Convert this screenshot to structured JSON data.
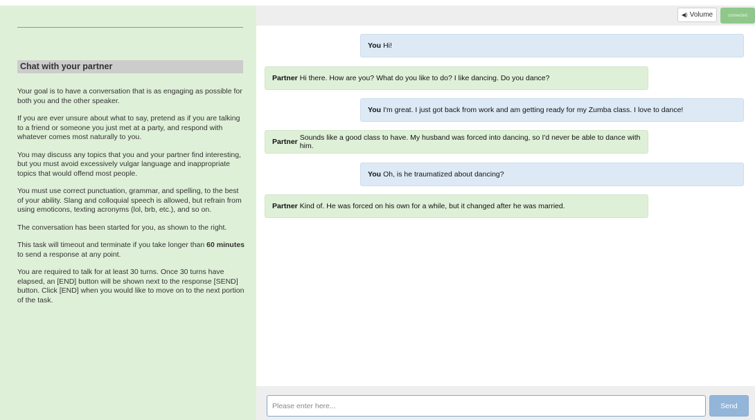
{
  "sidebar": {
    "heading": "Chat with your partner",
    "paragraphs": [
      "Your goal is to have a conversation that is as engaging as possible for both you and the other speaker.",
      "If you are ever unsure about what to say, pretend as if you are talking to a friend or someone you just met at a party, and respond with whatever comes most naturally to you.",
      "You may discuss any topics that you and your partner find interesting, but you must avoid excessively vulgar language and inappropriate topics that would offend most people.",
      "You must use correct punctuation, grammar, and spelling, to the best of your ability. Slang and colloquial speech is allowed, but refrain from using emoticons, texting acronyms (lol, brb, etc.), and so on.",
      "The conversation has been started for you, as shown to the right."
    ],
    "timeout": {
      "before": "This task will timeout and terminate if you take longer than ",
      "bold": "60 minutes",
      "after": " to send a response at any point."
    },
    "turns_note": "You are required to talk for at least 30 turns. Once 30 turns have elapsed, an [END] button will be shown next to the response [SEND] button. Click [END] when you would like to move on to the next portion of the task."
  },
  "header": {
    "volume_icon": "speaker-icon",
    "volume_glyph": "◀)",
    "volume_label": "Volume",
    "status_label": "connected",
    "status_color": "#8fc88a"
  },
  "messages": [
    {
      "speaker": "You",
      "text": "Hi!"
    },
    {
      "speaker": "Partner",
      "text": "Hi there. How are you? What do you like to do? I like dancing. Do you dance?"
    },
    {
      "speaker": "You",
      "text": "I'm great. I just got back from work and am getting ready for my Zumba class. I love to dance!"
    },
    {
      "speaker": "Partner",
      "text": "Sounds like a good class to have. My husband was forced into dancing, so I'd never be able to dance with him."
    },
    {
      "speaker": "You",
      "text": "Oh, is he traumatized about dancing?"
    },
    {
      "speaker": "Partner",
      "text": "Kind of. He was forced on his own for a while, but it changed after he was married."
    }
  ],
  "composer": {
    "placeholder": "Please enter here...",
    "value": "",
    "send_label": "Send"
  },
  "colors": {
    "sidebar_bg": "#dff0d8",
    "you_bubble": "#ddeaf6",
    "partner_bubble": "#dff0d8",
    "send_button": "#92b5d9"
  }
}
